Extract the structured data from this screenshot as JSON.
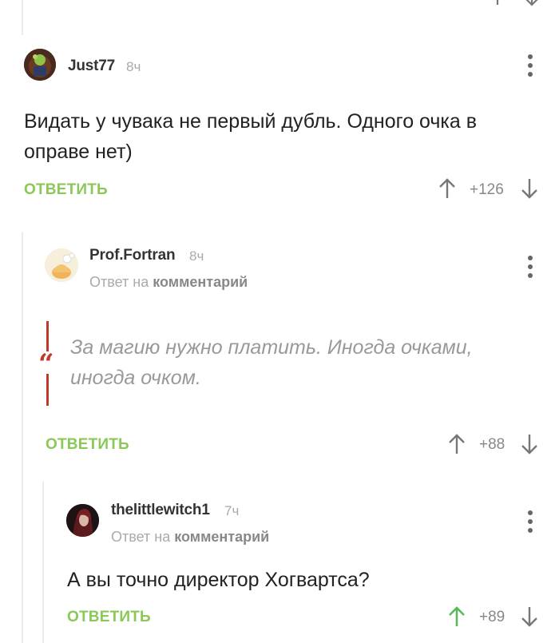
{
  "top_arrows": {
    "up": "up-arrow-icon",
    "down": "down-arrow-icon"
  },
  "comments": [
    {
      "username": "Just77",
      "time": "8ч",
      "text_line1": "Видать у чувака не первый дубль. Одного очка в",
      "text_line2": "оправе нет)",
      "reply_label": "ОТВЕТИТЬ",
      "score": "+126"
    },
    {
      "username": "Prof.Fortran",
      "time": "8ч",
      "reply_prefix": "Ответ на",
      "reply_target": "комментарий",
      "quote_line1": "За магию нужно платить. Иногда очками,",
      "quote_line2": "иногда очком.",
      "reply_label": "ОТВЕТИТЬ",
      "score": "+88"
    },
    {
      "username": "thelittlewitch1",
      "time": "7ч",
      "reply_prefix": "Ответ на",
      "reply_target": "комментарий",
      "text_line1": "А вы точно директор Хогвартса?",
      "reply_label": "ОТВЕТИТЬ",
      "score": "+89"
    }
  ],
  "colors": {
    "accent": "#8ac858",
    "quote": "#c0392b",
    "muted": "#aaaaaa",
    "upvoted": "#5cb85c"
  }
}
